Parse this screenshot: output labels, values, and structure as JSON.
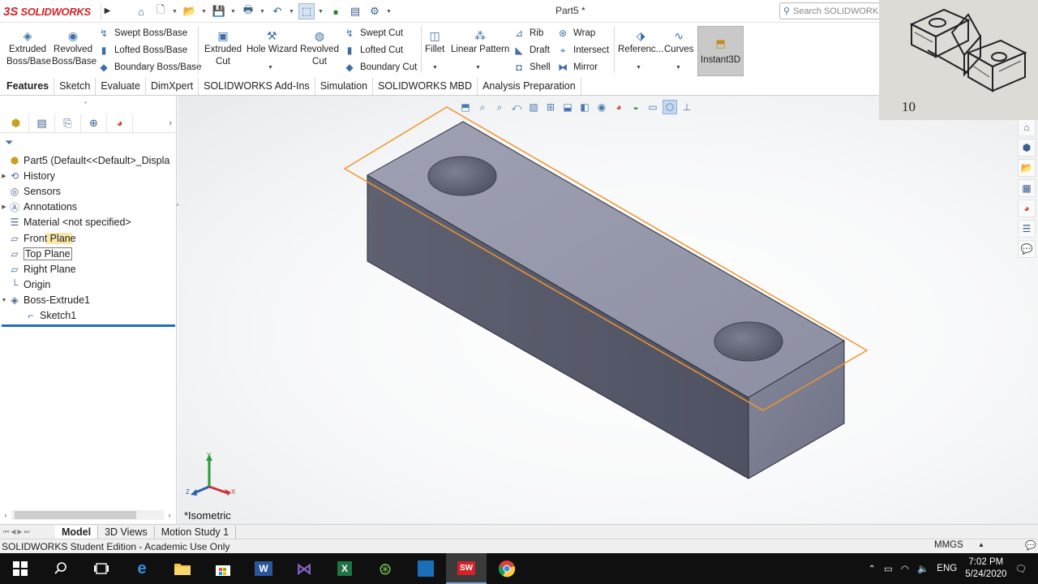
{
  "app": {
    "brand_ds": "3S",
    "brand_name": "SOLIDWORKS",
    "document_title": "Part5 *",
    "search_placeholder": "Search SOLIDWORKS"
  },
  "ribbon": {
    "extruded_boss": "Extruded Boss/Base",
    "revolved_boss": "Revolved Boss/Base",
    "swept_boss": "Swept Boss/Base",
    "lofted_boss": "Lofted Boss/Base",
    "boundary_boss": "Boundary Boss/Base",
    "extruded_cut": "Extruded Cut",
    "hole_wizard": "Hole Wizard",
    "revolved_cut": "Revolved Cut",
    "swept_cut": "Swept Cut",
    "lofted_cut": "Lofted Cut",
    "boundary_cut": "Boundary Cut",
    "fillet": "Fillet",
    "linear_pattern": "Linear Pattern",
    "rib": "Rib",
    "draft": "Draft",
    "shell": "Shell",
    "wrap": "Wrap",
    "intersect": "Intersect",
    "mirror": "Mirror",
    "reference": "Referenc...",
    "curves": "Curves",
    "instant3d": "Instant3D"
  },
  "tabs": [
    "Features",
    "Sketch",
    "Evaluate",
    "DimXpert",
    "SOLIDWORKS Add-Ins",
    "Simulation",
    "SOLIDWORKS MBD",
    "Analysis Preparation"
  ],
  "active_tab": "Features",
  "tree": {
    "root": "Part5  (Default<<Default>_Displa",
    "items": [
      "History",
      "Sensors",
      "Annotations",
      "Material <not specified>",
      "Front Plane",
      "Top Plane",
      "Right Plane",
      "Origin",
      "Boss-Extrude1",
      "Sketch1"
    ]
  },
  "graphics": {
    "view_label": "*Isometric",
    "triad_x": "X",
    "triad_y": "Y",
    "triad_z": "Z"
  },
  "webcam": {
    "sketch_number": "10"
  },
  "bottom_tabs": [
    "Model",
    "3D Views",
    "Motion Study 1"
  ],
  "active_bottom_tab": "Model",
  "status": {
    "edition": "SOLIDWORKS Student Edition - Academic Use Only",
    "units": "MMGS"
  },
  "taskbar": {
    "language": "ENG",
    "time": "7:02 PM",
    "date": "5/24/2020"
  },
  "colors": {
    "brand_red": "#d1232a",
    "plane_orange": "#f0962e",
    "body_top": "#9a9db0",
    "body_front": "#585b6a",
    "body_side": "#7d8090",
    "selection_blue": "#1f6fb8"
  }
}
